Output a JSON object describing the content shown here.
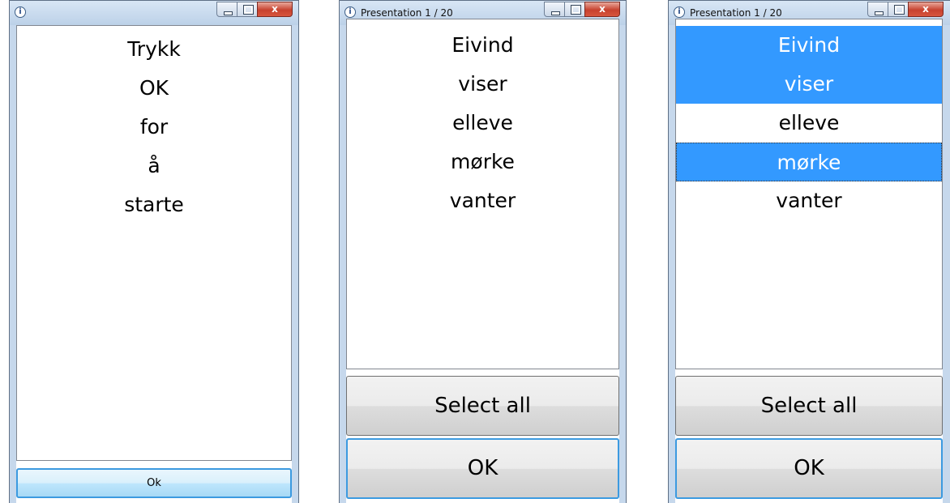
{
  "windows": [
    {
      "title": "",
      "items": [
        {
          "text": "Trykk",
          "selected": false
        },
        {
          "text": "OK",
          "selected": false
        },
        {
          "text": "for",
          "selected": false
        },
        {
          "text": "å",
          "selected": false
        },
        {
          "text": "starte",
          "selected": false
        }
      ],
      "ok_label": "Ok"
    },
    {
      "title": "Presentation 1 / 20",
      "items": [
        {
          "text": "Eivind",
          "selected": false
        },
        {
          "text": "viser",
          "selected": false
        },
        {
          "text": "elleve",
          "selected": false
        },
        {
          "text": "mørke",
          "selected": false
        },
        {
          "text": "vanter",
          "selected": false
        }
      ],
      "select_all_label": "Select all",
      "ok_label": "OK"
    },
    {
      "title": "Presentation 1 / 20",
      "items": [
        {
          "text": "Eivind",
          "selected": true
        },
        {
          "text": "viser",
          "selected": true
        },
        {
          "text": "elleve",
          "selected": false
        },
        {
          "text": "mørke",
          "selected": true,
          "focused": true
        },
        {
          "text": "vanter",
          "selected": false
        }
      ],
      "select_all_label": "Select all",
      "ok_label": "OK"
    }
  ],
  "colors": {
    "selection": "#3399ff",
    "frame": "#c6d8ec",
    "close_button": "#c7422f"
  }
}
